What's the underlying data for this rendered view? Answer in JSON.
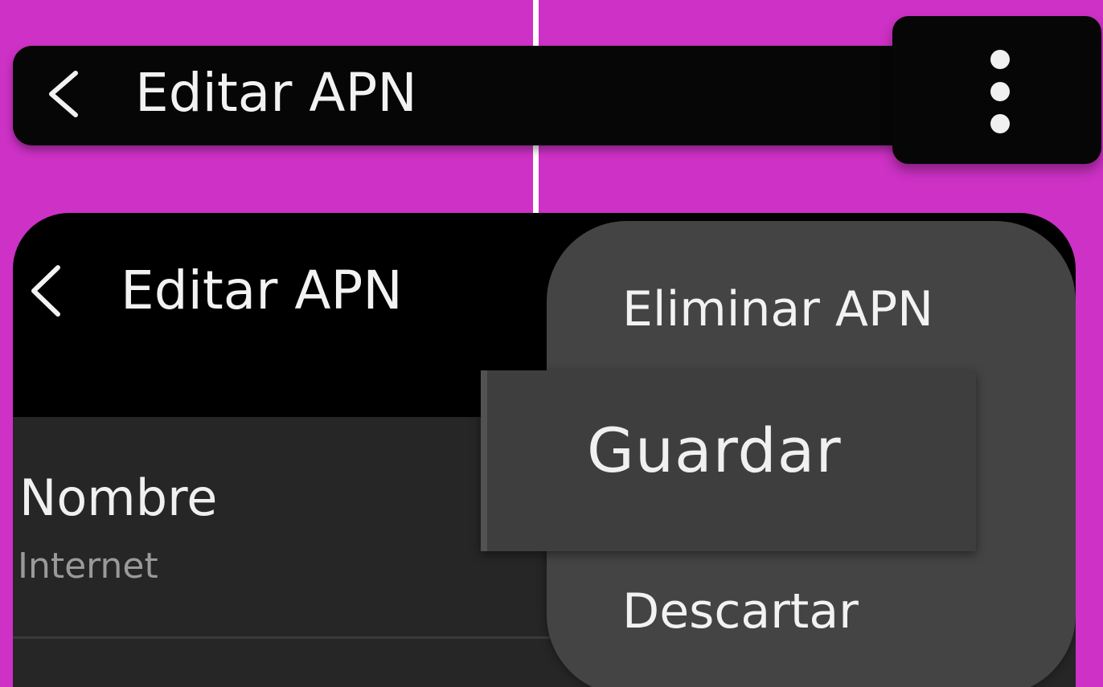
{
  "toolbar": {
    "title": "Editar APN",
    "back_icon": "chevron-left-icon",
    "more_icon": "more-vertical-icon"
  },
  "screen": {
    "title": "Editar APN",
    "back_icon": "chevron-left-icon"
  },
  "fields": [
    {
      "label": "Nombre",
      "value": "Internet"
    }
  ],
  "overflow_menu": {
    "items": [
      "Eliminar APN",
      "Guardar",
      "Descartar"
    ],
    "highlighted": "Guardar"
  },
  "colors": {
    "background": "#cd31c5",
    "bar": "#060606",
    "menu": "#444444",
    "highlight": "#3e3e3e"
  }
}
